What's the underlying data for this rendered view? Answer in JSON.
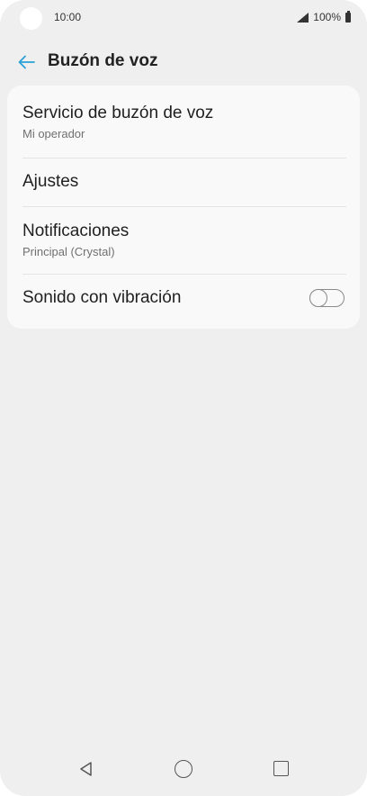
{
  "status_bar": {
    "time": "10:00",
    "battery": "100%"
  },
  "header": {
    "title": "Buzón de voz",
    "back_icon": "arrow-left-icon",
    "accent_color": "#2aa1d6"
  },
  "settings": {
    "items": [
      {
        "title": "Servicio de buzón de voz",
        "subtitle": "Mi operador"
      },
      {
        "title": "Ajustes"
      },
      {
        "title": "Notificaciones",
        "subtitle": "Principal (Crystal)"
      },
      {
        "title": "Sonido con vibración",
        "toggle_on": false
      }
    ]
  },
  "nav_bar": {
    "back_icon": "triangle-back-icon",
    "home_icon": "circle-home-icon",
    "recents_icon": "square-recents-icon"
  }
}
